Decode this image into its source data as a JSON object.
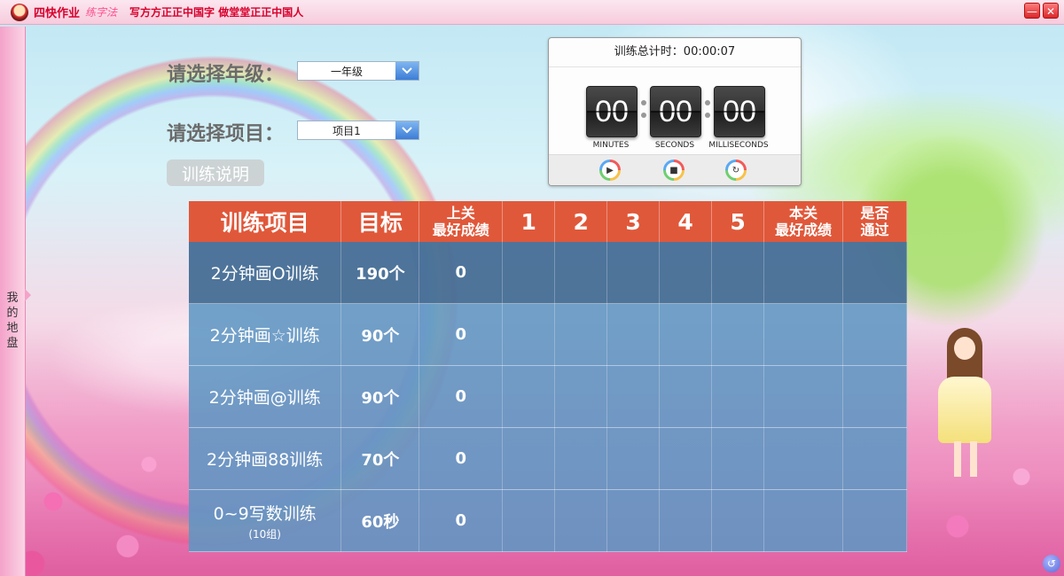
{
  "titlebar": {
    "app_name": "四快作业",
    "app_sub": "练字法",
    "slogan": "写方方正正中国字 做堂堂正正中国人",
    "minimize_label": "—",
    "close_label": "✕"
  },
  "sidebar": {
    "tab_label": "我的地盘"
  },
  "form": {
    "grade_label": "请选择年级：",
    "grade_value": "一年级",
    "project_label": "请选择项目：",
    "project_value": "项目1",
    "help_button": "训练说明"
  },
  "timer": {
    "title": "训练总计时：00:00:07",
    "minutes": "00",
    "seconds": "00",
    "milliseconds": "00",
    "minutes_label": "MINUTES",
    "seconds_label": "SECONDS",
    "milliseconds_label": "MILLISECONDS",
    "play_icon": "▶",
    "stop_icon": "■",
    "reset_icon": "↻"
  },
  "table": {
    "headers": {
      "item": "训练项目",
      "target": "目标",
      "prev_best_1": "上关",
      "prev_best_2": "最好成绩",
      "r1": "1",
      "r2": "2",
      "r3": "3",
      "r4": "4",
      "r5": "5",
      "cur_best_1": "本关",
      "cur_best_2": "最好成绩",
      "pass_1": "是否",
      "pass_2": "通过"
    },
    "rows": [
      {
        "name": "2分钟画O训练",
        "note": "",
        "target": "190个",
        "prev_best": "0",
        "r1": "",
        "r2": "",
        "r3": "",
        "r4": "",
        "r5": "",
        "cur_best": "",
        "pass": ""
      },
      {
        "name": "2分钟画☆训练",
        "note": "",
        "target": "90个",
        "prev_best": "0",
        "r1": "",
        "r2": "",
        "r3": "",
        "r4": "",
        "r5": "",
        "cur_best": "",
        "pass": ""
      },
      {
        "name": "2分钟画@训练",
        "note": "",
        "target": "90个",
        "prev_best": "0",
        "r1": "",
        "r2": "",
        "r3": "",
        "r4": "",
        "r5": "",
        "cur_best": "",
        "pass": ""
      },
      {
        "name": "2分钟画88训练",
        "note": "",
        "target": "70个",
        "prev_best": "0",
        "r1": "",
        "r2": "",
        "r3": "",
        "r4": "",
        "r5": "",
        "cur_best": "",
        "pass": ""
      },
      {
        "name": "0~9写数训练",
        "note": "(10组)",
        "target": "60秒",
        "prev_best": "0",
        "r1": "",
        "r2": "",
        "r3": "",
        "r4": "",
        "r5": "",
        "cur_best": "",
        "pass": ""
      }
    ]
  },
  "corner": {
    "back_icon": "↺"
  }
}
